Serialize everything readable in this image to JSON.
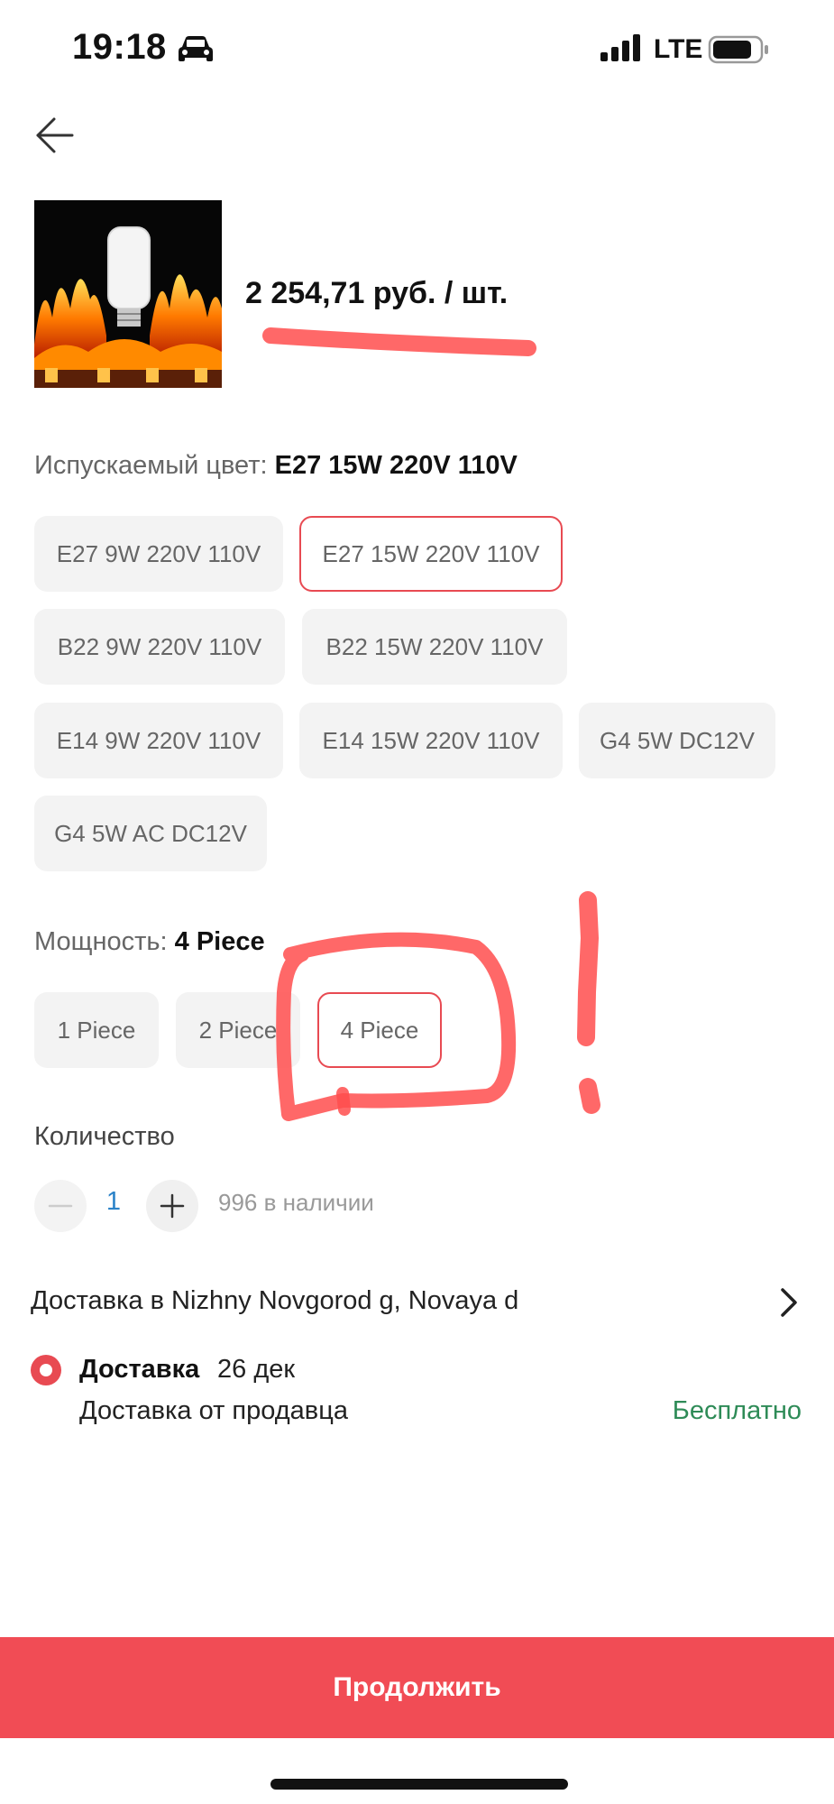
{
  "status_bar": {
    "time": "19:18",
    "network": "LTE"
  },
  "product": {
    "price": "2 254,71 руб. / шт."
  },
  "color": {
    "label": "Испускаемый цвет:",
    "selected": "E27 15W 220V 110V",
    "options": [
      "E27 9W 220V 110V",
      "E27 15W 220V 110V",
      "B22 9W 220V 110V",
      "B22 15W 220V 110V",
      "E14 9W 220V 110V",
      "E14 15W 220V 110V",
      "G4 5W DC12V",
      "G4 5W AC DC12V"
    ]
  },
  "power": {
    "label": "Мощность:",
    "selected": "4 Piece",
    "options": [
      "1 Piece",
      "2 Piece",
      "4 Piece"
    ]
  },
  "quantity": {
    "label": "Количество",
    "value": "1",
    "stock": "996 в наличии"
  },
  "delivery": {
    "address": "Доставка в Nizhny Novgorod g, Novaya d",
    "method": "Доставка",
    "date": "26 дек",
    "seller": "Доставка от продавца",
    "cost": "Бесплатно"
  },
  "continue_label": "Продолжить",
  "colors": {
    "accent": "#f14c55",
    "selected_border": "#e84a52",
    "free_text": "#2e8b57",
    "quantity_value": "#2a82c8"
  }
}
